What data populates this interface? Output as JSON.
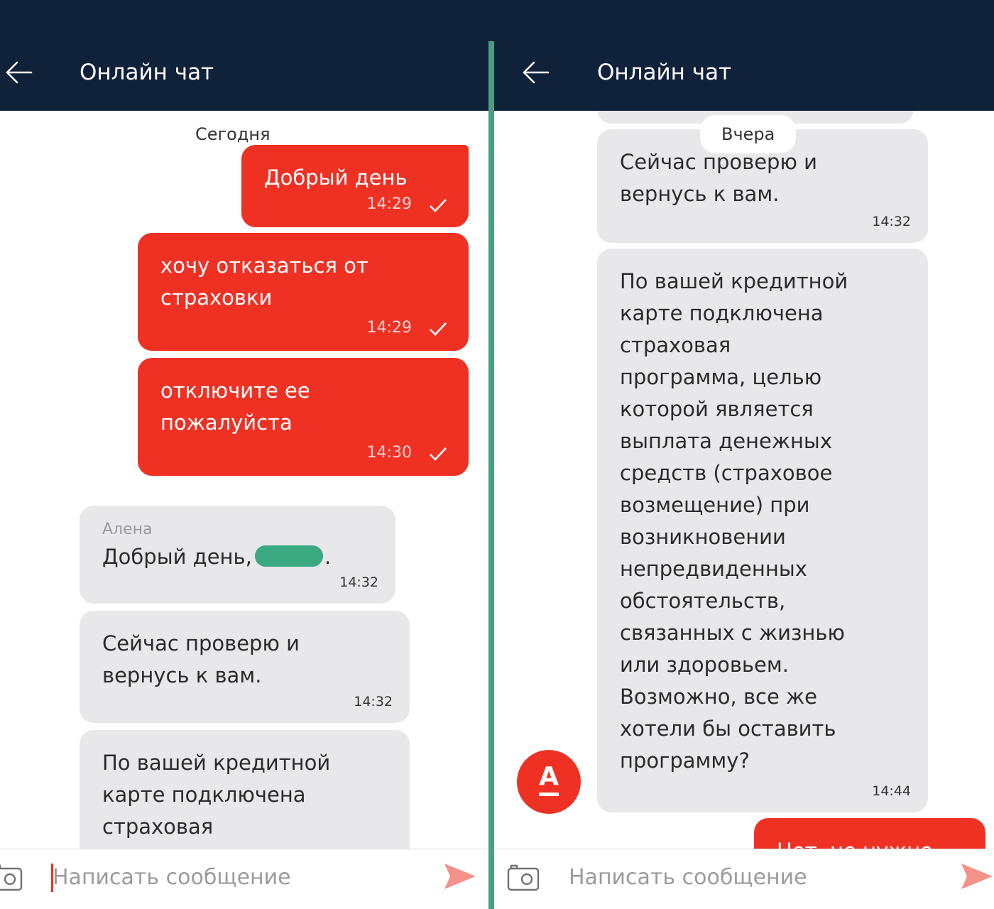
{
  "header": {
    "title": "Онлайн чат"
  },
  "input": {
    "placeholder": "Написать сообщение"
  },
  "left_chat": {
    "date_label": "Сегодня",
    "messages": [
      {
        "direction": "out",
        "text": "Добрый день",
        "time": "14:29"
      },
      {
        "direction": "out",
        "text": "хочу отказаться от\nстраховки",
        "time": "14:29"
      },
      {
        "direction": "out",
        "text": "отключите ее\nпожалуйста",
        "time": "14:30"
      },
      {
        "direction": "in",
        "author": "Алена",
        "text": "Добрый день,",
        "text_suffix": ".",
        "time": "14:32"
      },
      {
        "direction": "in",
        "text": "Сейчас проверю и\nвернусь к вам.",
        "time": "14:32"
      },
      {
        "direction": "in",
        "text": "По вашей кредитной\nкарте подключена\nстраховая\nпрограмма, целью",
        "time": ""
      }
    ]
  },
  "right_chat": {
    "date_label": "Вчера",
    "messages": [
      {
        "direction": "in",
        "text": "Сейчас проверю и\nвернусь к вам.",
        "time": "14:32"
      },
      {
        "direction": "in",
        "text": "По вашей кредитной\nкарте подключена\nстраховая\nпрограмма, целью\nкоторой является\nвыплата денежных\nсредств (страховое\nвозмещение) при\nвозникновении\nнепредвиденных\nобстоятельств,\nсвязанных с жизнью\nили здоровьем.\nВозможно, все же\nхотели бы оставить\nпрограмму?",
        "time": "14:44"
      },
      {
        "direction": "out",
        "text": "Нет, не нужно",
        "time": ""
      }
    ],
    "avatar_letter": "А"
  },
  "colors": {
    "header_bg": "#10213a",
    "outgoing": "#ef3124",
    "incoming": "#e8e8ea",
    "divider": "#48a080",
    "censor": "#3aa982"
  },
  "icons": [
    "back-arrow-icon",
    "check-icon",
    "camera-icon",
    "send-icon",
    "alfa-bank-logo-icon"
  ]
}
